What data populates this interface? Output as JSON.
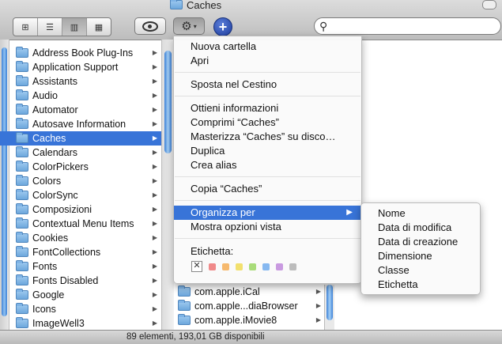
{
  "window": {
    "title": "Caches"
  },
  "toolbar": {
    "view_modes": [
      {
        "name": "icon-view",
        "glyph": "⊞",
        "selected": false
      },
      {
        "name": "list-view",
        "glyph": "☰",
        "selected": false
      },
      {
        "name": "column-view",
        "glyph": "▥",
        "selected": true
      },
      {
        "name": "coverflow-view",
        "glyph": "▦",
        "selected": false
      }
    ],
    "gear_glyph": "⚙",
    "gear_arrow": "▾",
    "plus_glyph": "+",
    "search_glyph": "⚲",
    "search_value": ""
  },
  "column1": {
    "items": [
      {
        "label": "Address Book Plug-Ins",
        "selected": false
      },
      {
        "label": "Application Support",
        "selected": false
      },
      {
        "label": "Assistants",
        "selected": false
      },
      {
        "label": "Audio",
        "selected": false
      },
      {
        "label": "Automator",
        "selected": false
      },
      {
        "label": "Autosave Information",
        "selected": false
      },
      {
        "label": "Caches",
        "selected": true
      },
      {
        "label": "Calendars",
        "selected": false
      },
      {
        "label": "ColorPickers",
        "selected": false
      },
      {
        "label": "Colors",
        "selected": false
      },
      {
        "label": "ColorSync",
        "selected": false
      },
      {
        "label": "Composizioni",
        "selected": false
      },
      {
        "label": "Contextual Menu Items",
        "selected": false
      },
      {
        "label": "Cookies",
        "selected": false
      },
      {
        "label": "FontCollections",
        "selected": false
      },
      {
        "label": "Fonts",
        "selected": false
      },
      {
        "label": "Fonts Disabled",
        "selected": false
      },
      {
        "label": "Google",
        "selected": false
      },
      {
        "label": "Icons",
        "selected": false
      },
      {
        "label": "ImageWell3",
        "selected": false
      }
    ],
    "arrow_glyph": "▶"
  },
  "column2": {
    "items": [
      {
        "label": "com.apple.iCal"
      },
      {
        "label": "com.apple...diaBrowser"
      },
      {
        "label": "com.apple.iMovie8"
      }
    ]
  },
  "context_menu": {
    "items": [
      {
        "label": "Nuova cartella"
      },
      {
        "label": "Apri"
      },
      {
        "label": "Sposta nel Cestino"
      },
      {
        "label": "Ottieni informazioni"
      },
      {
        "label": "Comprimi “Caches”"
      },
      {
        "label": "Masterizza “Caches” su disco…"
      },
      {
        "label": "Duplica"
      },
      {
        "label": "Crea alias"
      },
      {
        "label": "Copia “Caches”"
      },
      {
        "label": "Organizza per",
        "highlighted": true,
        "has_submenu": true
      },
      {
        "label": "Mostra opzioni vista"
      }
    ],
    "submenu_arrow": "▶",
    "tag_label": "Etichetta:",
    "tag_clear_glyph": "✕",
    "tag_colors": [
      "#f08a8a",
      "#f6b96e",
      "#f2e06e",
      "#a9dc7a",
      "#86b8f0",
      "#c99ae0",
      "#bcbcbc"
    ]
  },
  "submenu": {
    "items": [
      {
        "label": "Nome"
      },
      {
        "label": "Data di modifica"
      },
      {
        "label": "Data di creazione"
      },
      {
        "label": "Dimensione"
      },
      {
        "label": "Classe"
      },
      {
        "label": "Etichetta"
      }
    ]
  },
  "status_bar": {
    "text": "89 elementi, 193,01 GB disponibili"
  }
}
